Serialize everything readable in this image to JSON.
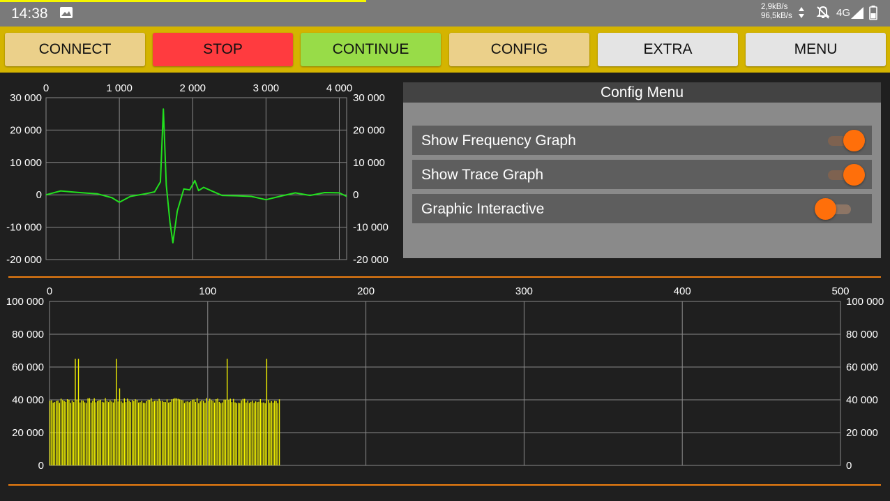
{
  "status_bar": {
    "time": "14:38",
    "net_up": "2,9kB/s",
    "net_down": "96,5kB/s",
    "network_type": "4G",
    "icons": [
      "image-icon",
      "updown-arrows-icon",
      "bell-muted-icon",
      "signal-icon",
      "battery-icon"
    ]
  },
  "toolbar": {
    "buttons": [
      {
        "label": "CONNECT",
        "color": "#ebd08a"
      },
      {
        "label": "STOP",
        "color": "#ff3b3f"
      },
      {
        "label": "CONTINUE",
        "color": "#98dc48"
      },
      {
        "label": "CONFIG",
        "color": "#ebd08a"
      },
      {
        "label": "EXTRA",
        "color": "#e4e4e4"
      },
      {
        "label": "MENU",
        "color": "#e4e4e4"
      }
    ]
  },
  "config_menu": {
    "title": "Config Menu",
    "options": [
      {
        "label": "Show Frequency Graph",
        "enabled": true
      },
      {
        "label": "Show Trace Graph",
        "enabled": true
      },
      {
        "label": "Graphic Interactive",
        "enabled": false
      }
    ],
    "accent_color": "#ff6f0a"
  },
  "chart_data": [
    {
      "type": "line",
      "color": "#22e01e",
      "x_ticks": [
        "0",
        "1 000",
        "2 000",
        "3 000",
        "4 000"
      ],
      "y_ticks": [
        "30 000",
        "20 000",
        "10 000",
        "0",
        "-10 000",
        "-20 000"
      ],
      "xlim": [
        0,
        4100
      ],
      "ylim": [
        -20000,
        30000
      ],
      "grid": true,
      "points": [
        [
          0,
          0
        ],
        [
          200,
          1200
        ],
        [
          400,
          800
        ],
        [
          700,
          300
        ],
        [
          900,
          -900
        ],
        [
          1000,
          -2300
        ],
        [
          1150,
          -500
        ],
        [
          1350,
          300
        ],
        [
          1480,
          900
        ],
        [
          1560,
          4000
        ],
        [
          1600,
          26500
        ],
        [
          1640,
          3000
        ],
        [
          1690,
          -8500
        ],
        [
          1730,
          -14800
        ],
        [
          1790,
          -5000
        ],
        [
          1880,
          1800
        ],
        [
          1960,
          1500
        ],
        [
          2030,
          4400
        ],
        [
          2080,
          1300
        ],
        [
          2150,
          2300
        ],
        [
          2250,
          1300
        ],
        [
          2400,
          -200
        ],
        [
          2600,
          -300
        ],
        [
          2800,
          -500
        ],
        [
          3000,
          -1500
        ],
        [
          3200,
          -400
        ],
        [
          3400,
          600
        ],
        [
          3600,
          -200
        ],
        [
          3800,
          700
        ],
        [
          4000,
          600
        ],
        [
          4100,
          -500
        ]
      ]
    },
    {
      "type": "bar",
      "color": "#f5f500",
      "x_ticks": [
        "0",
        "100",
        "200",
        "300",
        "400",
        "500"
      ],
      "y_ticks": [
        "100 000",
        "80 000",
        "60 000",
        "40 000",
        "20 000",
        "0"
      ],
      "xlim": [
        0,
        500
      ],
      "ylim": [
        0,
        100000
      ],
      "grid": true,
      "n_bars": 146,
      "baseline": 39500,
      "spikes": [
        {
          "x": 16,
          "value": 65000
        },
        {
          "x": 18,
          "value": 65000
        },
        {
          "x": 42,
          "value": 65000
        },
        {
          "x": 44,
          "value": 47000
        },
        {
          "x": 112,
          "value": 65000
        },
        {
          "x": 137,
          "value": 65000
        }
      ]
    }
  ]
}
